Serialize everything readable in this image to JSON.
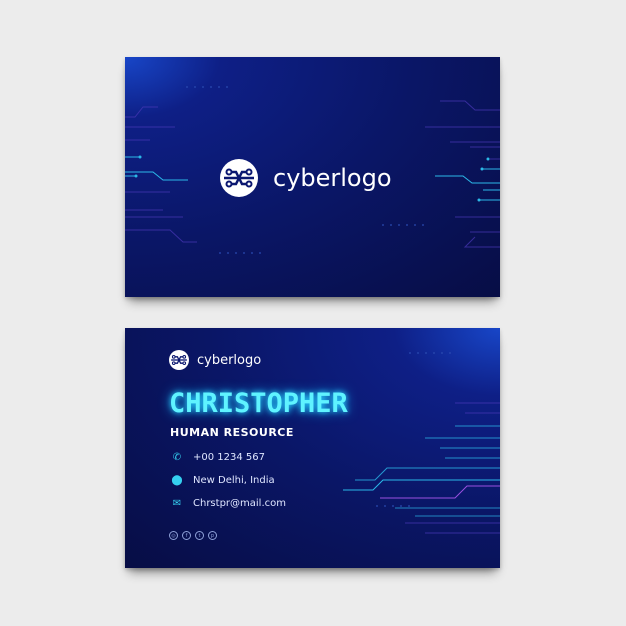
{
  "front": {
    "brand": "cyberlogo"
  },
  "back": {
    "brand": "cyberlogo",
    "name": "CHRISTOPHER",
    "role": "HUMAN RESOURCE",
    "contacts": [
      {
        "icon": "phone-icon",
        "text": "+00 1234 567"
      },
      {
        "icon": "location-pin-icon",
        "text": "New Delhi, India"
      },
      {
        "icon": "mail-icon",
        "text": "Chrstpr@mail.com"
      }
    ],
    "social": [
      "instagram-icon",
      "facebook-icon",
      "twitter-icon",
      "pinterest-icon"
    ]
  },
  "colors": {
    "card": "#0a1666",
    "accent": "#5ff3ff",
    "circuit": "#2bb8e8",
    "circuit_purple": "#7a4ad8"
  }
}
